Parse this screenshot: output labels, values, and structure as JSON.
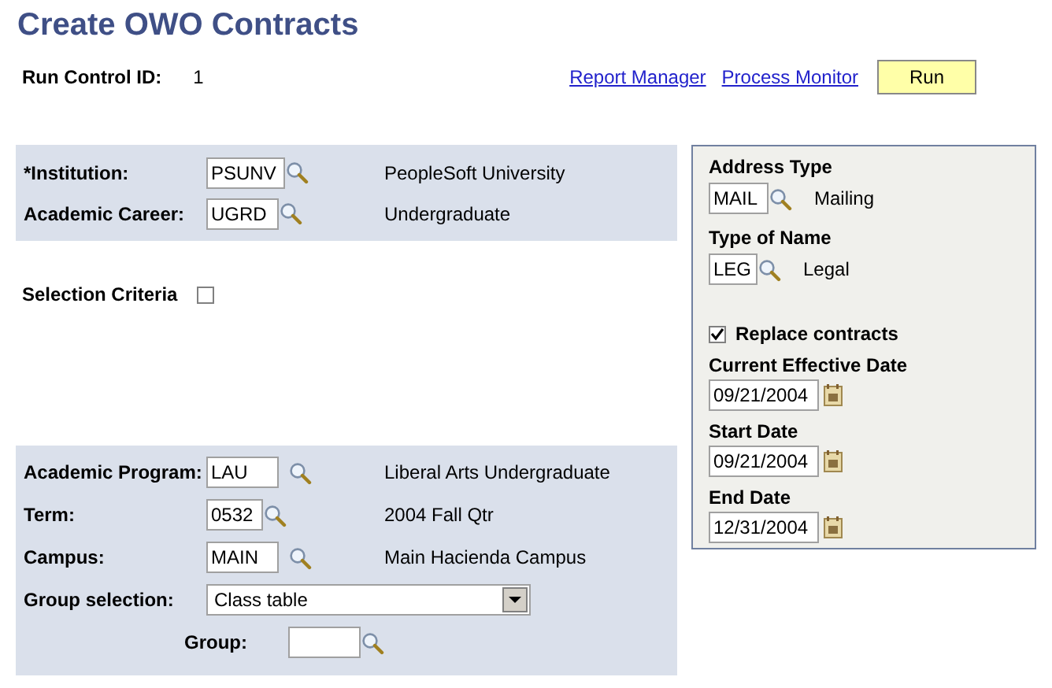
{
  "title": "Create OWO Contracts",
  "run_control": {
    "label": "Run Control ID:",
    "value": "1"
  },
  "links": [
    "Report Manager",
    "Process Monitor"
  ],
  "run_button": "Run",
  "top_fields": [
    {
      "label": "*Institution:",
      "value": "PSUNV",
      "description": "PeopleSoft University"
    },
    {
      "label": "Academic Career:",
      "value": "UGRD",
      "description": "Undergraduate"
    }
  ],
  "selection_criteria": {
    "label": "Selection Criteria",
    "checked": false
  },
  "bottom_fields": [
    {
      "label": "Academic Program:",
      "value": "LAU",
      "description": "Liberal Arts Undergraduate"
    },
    {
      "label": "Term:",
      "value": "0532",
      "description": "2004 Fall Qtr"
    },
    {
      "label": "Campus:",
      "value": "MAIN",
      "description": "Main Hacienda Campus"
    }
  ],
  "group_selection": {
    "label": "Group selection:",
    "value": "Class table"
  },
  "group": {
    "label": "Group:"
  },
  "right_panel": {
    "lookups": [
      {
        "label": "Address Type",
        "value": "MAIL",
        "description": "Mailing"
      },
      {
        "label": "Type of Name",
        "value": "LEG",
        "description": "Legal"
      }
    ],
    "replace": {
      "label": "Replace contracts",
      "checked": true
    },
    "dates": [
      {
        "label": "Current Effective Date",
        "value": "09/21/2004"
      },
      {
        "label": "Start Date",
        "value": "09/21/2004"
      },
      {
        "label": "End Date",
        "value": "12/31/2004"
      }
    ]
  }
}
